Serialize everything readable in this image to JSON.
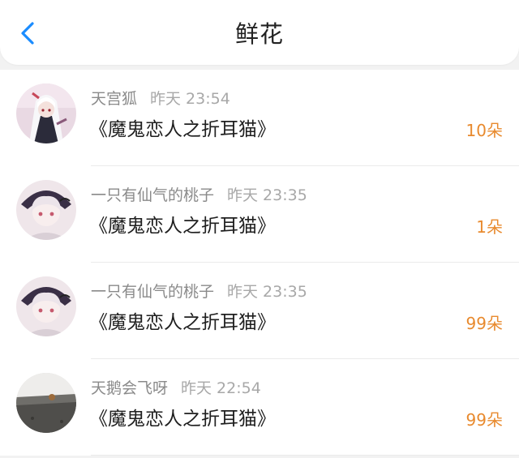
{
  "header": {
    "title": "鲜花"
  },
  "colors": {
    "accent": "#1a8cff",
    "amount": "#e88a2e"
  },
  "items": [
    {
      "user": "天宫狐",
      "time": "昨天 23:54",
      "book": "《魔鬼恋人之折耳猫》",
      "amount": "10朵"
    },
    {
      "user": "一只有仙气的桃子",
      "time": "昨天 23:35",
      "book": "《魔鬼恋人之折耳猫》",
      "amount": "1朵"
    },
    {
      "user": "一只有仙气的桃子",
      "time": "昨天 23:35",
      "book": "《魔鬼恋人之折耳猫》",
      "amount": "99朵"
    },
    {
      "user": "天鹅会飞呀",
      "time": "昨天 22:54",
      "book": "《魔鬼恋人之折耳猫》",
      "amount": "99朵"
    }
  ]
}
